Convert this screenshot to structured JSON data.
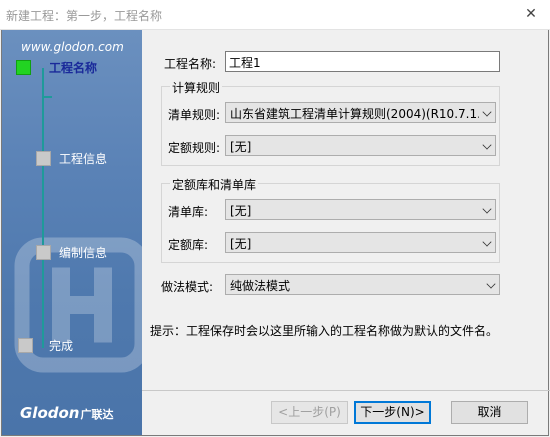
{
  "window": {
    "title": "新建工程：第一步，工程名称",
    "close_glyph": "✕"
  },
  "sidebar": {
    "url": "www.glodon.com",
    "steps": [
      {
        "label": "工程名称",
        "active": true
      },
      {
        "label": "工程信息",
        "active": false
      },
      {
        "label": "编制信息",
        "active": false
      },
      {
        "label": "完成",
        "active": false
      }
    ],
    "logo_text": "Glodon",
    "logo_cn": "广联达"
  },
  "form": {
    "project_name_label": "工程名称:",
    "project_name_value": "工程1",
    "calc_rules_group": "计算规则",
    "list_rule_label": "清单规则:",
    "list_rule_value": "山东省建筑工程清单计算规则(2004)(R10.7.1.",
    "quota_rule_label": "定额规则:",
    "quota_rule_value": "[无]",
    "library_group": "定额库和清单库",
    "list_lib_label": "清单库:",
    "list_lib_value": "[无]",
    "quota_lib_label": "定额库:",
    "quota_lib_value": "[无]",
    "method_label": "做法模式:",
    "method_value": "纯做法模式",
    "hint": "提示：工程保存时会以这里所输入的工程名称做为默认的文件名。"
  },
  "buttons": {
    "prev": "<上一步(P)",
    "next": "下一步(N)>",
    "cancel": "取消"
  },
  "colors": {
    "sidebar": "#5a82b6",
    "active_step": "#22d322",
    "default_button_border": "#0078d7"
  }
}
